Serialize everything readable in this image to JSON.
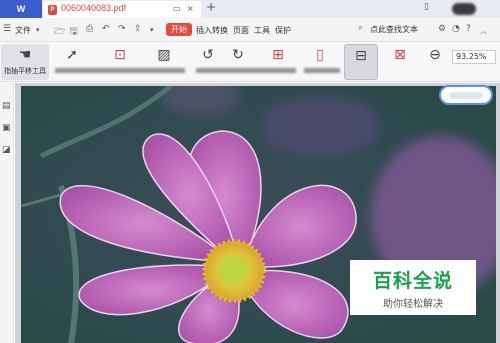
{
  "app": {
    "logo_label": "W"
  },
  "tab": {
    "title": "0060040083.pdf",
    "restore_glyph": "▭",
    "close_glyph": "×"
  },
  "titlebar": {
    "new_tab": "+"
  },
  "menu": {
    "file": "文件",
    "start": "开始",
    "items": [
      "插入",
      "转换",
      "页面",
      "工具",
      "保护"
    ],
    "search": "点此查找文本"
  },
  "ribbon": {
    "hand_tool_label": "指抽平移工具",
    "zoom_value": "93.25%"
  },
  "colors": {
    "accent_red": "#e34b3a",
    "brand_blue": "#3a5fcd",
    "watermark_green": "#1aa24b"
  },
  "watermark": {
    "title": "百科全说",
    "subtitle": "助你轻松解决"
  }
}
